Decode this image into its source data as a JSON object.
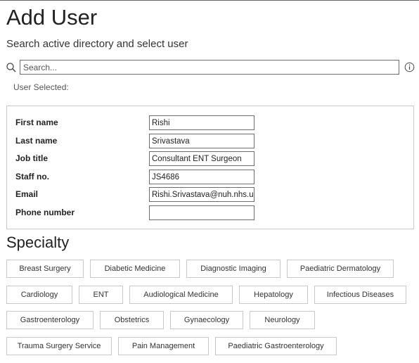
{
  "page": {
    "title": "Add User",
    "subtitle": "Search active directory and select user"
  },
  "search": {
    "placeholder": "Search...",
    "value": "",
    "icon": "search-icon",
    "info_icon": "info-icon"
  },
  "user_selected_label": "User Selected:",
  "fields": [
    {
      "label": "First name",
      "value": "Rishi"
    },
    {
      "label": "Last name",
      "value": "Srivastava"
    },
    {
      "label": "Job title",
      "value": "Consultant ENT Surgeon"
    },
    {
      "label": "Staff no.",
      "value": "JS4686"
    },
    {
      "label": "Email",
      "value": "Rishi.Srivastava@nuh.nhs.uk"
    },
    {
      "label": "Phone number",
      "value": ""
    }
  ],
  "specialty": {
    "heading": "Specialty",
    "chips": [
      "Breast Surgery",
      "Diabetic Medicine",
      "Diagnostic Imaging",
      "Paediatric Dermatology",
      "Cardiology",
      "ENT",
      "Audiological Medicine",
      "Hepatology",
      "Infectious Diseases",
      "Gastroenterology",
      "Obstetrics",
      "Gynaecology",
      "Neurology",
      "Trauma Surgery Service",
      "Pain Management",
      "Paediatric Gastroenterology"
    ]
  },
  "colors": {
    "border": "#c8c8c8",
    "input_border": "#6b6b6b",
    "text": "#222222"
  }
}
